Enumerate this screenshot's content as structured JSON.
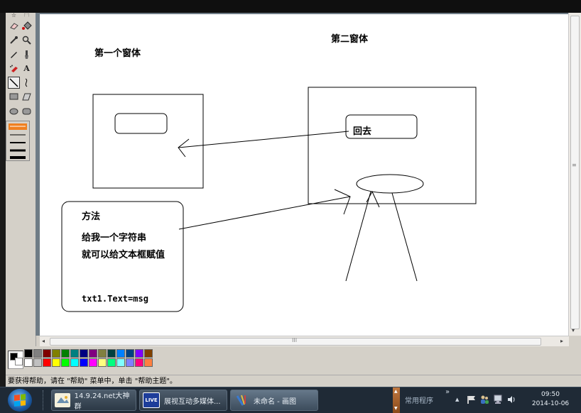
{
  "status": {
    "help_text": "要获得帮助，请在 \"帮助\" 菜单中，单击 \"帮助主题\"。"
  },
  "canvas": {
    "window1_title": "第一个窗体",
    "window2_title": "第二窗体",
    "button_back": "回去",
    "note_line1": "方法",
    "note_line2": "给我一个字符串",
    "note_line3": "就可以给文本框赋值",
    "note_line4": "txt1.Text=msg"
  },
  "scrollbar": {
    "grip": "III",
    "vgrip": "≡"
  },
  "palette": {
    "row1": [
      "#000000",
      "#808080",
      "#800000",
      "#808000",
      "#008000",
      "#008080",
      "#000080",
      "#800080",
      "#808040",
      "#004040",
      "#0080ff",
      "#004080",
      "#8000ff",
      "#804000"
    ],
    "row2": [
      "#ffffff",
      "#c0c0c0",
      "#ff0000",
      "#ffff00",
      "#00ff00",
      "#00ffff",
      "#0000ff",
      "#ff00ff",
      "#ffff80",
      "#00ff80",
      "#80ffff",
      "#8080ff",
      "#ff0080",
      "#ff8040"
    ]
  },
  "taskbar": {
    "tasks": [
      {
        "label": "14.9.24.net大神群",
        "icon": "qq-group-icon"
      },
      {
        "label": "展视互动多媒体...",
        "icon": "live-icon",
        "icon_text": "LIVE"
      },
      {
        "label": "未命名 - 画图",
        "icon": "paint-icon"
      }
    ],
    "tray_label": "常用程序",
    "tray_chevron": "»",
    "tray_up": "▲",
    "clock_time": "09:50",
    "clock_date": "2014-10-06"
  }
}
